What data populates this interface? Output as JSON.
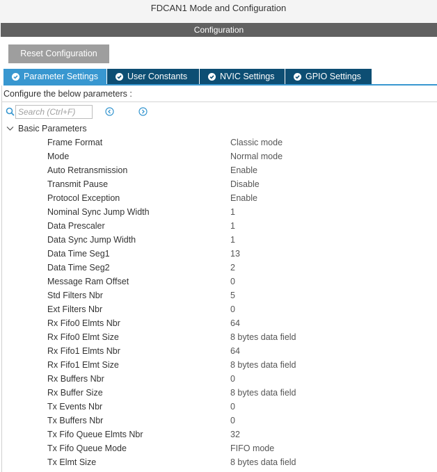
{
  "window": {
    "title": "FDCAN1 Mode and Configuration"
  },
  "section": {
    "title": "Configuration"
  },
  "toolbar": {
    "reset_label": "Reset Configuration"
  },
  "tabs": [
    {
      "label": "Parameter Settings",
      "active": true
    },
    {
      "label": "User Constants",
      "active": false
    },
    {
      "label": "NVIC Settings",
      "active": false
    },
    {
      "label": "GPIO Settings",
      "active": false
    }
  ],
  "configure_label": "Configure the below parameters :",
  "search": {
    "placeholder": "Search (Ctrl+F)",
    "value": ""
  },
  "icons": {
    "search": "search-icon",
    "prev": "arrow-left-circle-icon",
    "next": "arrow-right-circle-icon",
    "collapse": "chevron-down-icon",
    "tab_check": "check-circle-icon"
  },
  "colors": {
    "active_tab": "#3897d0",
    "inactive_tab": "#0d4e73",
    "header_bar": "#616161",
    "reset_button": "#9e9e9e"
  },
  "group": {
    "label": "Basic Parameters",
    "expanded": true,
    "params": [
      {
        "name": "Frame Format",
        "value": "Classic mode"
      },
      {
        "name": "Mode",
        "value": "Normal mode"
      },
      {
        "name": "Auto Retransmission",
        "value": "Enable"
      },
      {
        "name": "Transmit Pause",
        "value": "Disable"
      },
      {
        "name": "Protocol Exception",
        "value": "Enable"
      },
      {
        "name": "Nominal Sync Jump Width",
        "value": "1"
      },
      {
        "name": "Data Prescaler",
        "value": "1"
      },
      {
        "name": "Data Sync Jump Width",
        "value": "1"
      },
      {
        "name": "Data Time Seg1",
        "value": "13"
      },
      {
        "name": "Data Time Seg2",
        "value": "2"
      },
      {
        "name": "Message Ram Offset",
        "value": "0"
      },
      {
        "name": "Std Filters Nbr",
        "value": "5"
      },
      {
        "name": "Ext Filters Nbr",
        "value": "0"
      },
      {
        "name": "Rx Fifo0 Elmts Nbr",
        "value": "64"
      },
      {
        "name": "Rx Fifo0 Elmt Size",
        "value": "8 bytes data field"
      },
      {
        "name": "Rx Fifo1 Elmts Nbr",
        "value": "64"
      },
      {
        "name": "Rx Fifo1 Elmt Size",
        "value": "8 bytes data field"
      },
      {
        "name": "Rx Buffers Nbr",
        "value": "0"
      },
      {
        "name": "Rx Buffer Size",
        "value": "8 bytes data field"
      },
      {
        "name": "Tx Events Nbr",
        "value": "0"
      },
      {
        "name": "Tx Buffers Nbr",
        "value": "0"
      },
      {
        "name": "Tx Fifo Queue Elmts Nbr",
        "value": "32"
      },
      {
        "name": "Tx Fifo Queue Mode",
        "value": "FIFO mode"
      },
      {
        "name": "Tx Elmt Size",
        "value": "8 bytes data field"
      }
    ]
  }
}
